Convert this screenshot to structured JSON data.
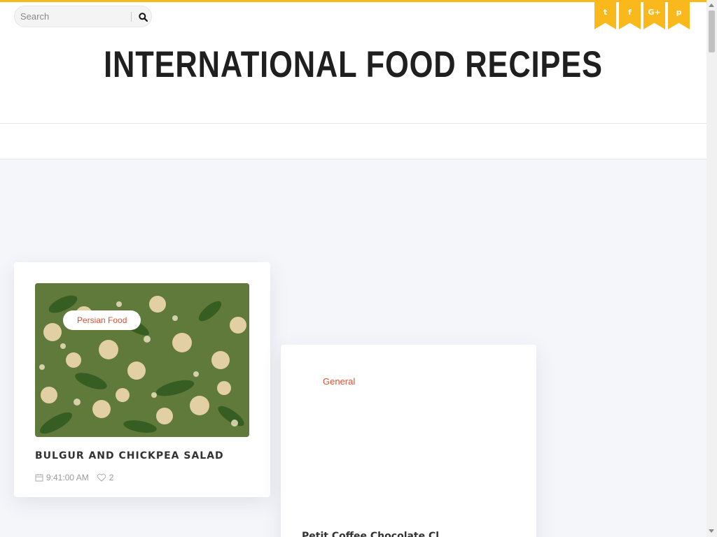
{
  "search": {
    "placeholder": "Search"
  },
  "social": [
    "twitter-icon",
    "facebook-icon",
    "google-plus-icon",
    "pinterest-icon"
  ],
  "social_glyphs": {
    "twitter": "t",
    "facebook": "f",
    "google": "G+",
    "pinterest": "p"
  },
  "site": {
    "title": "INTERNATIONAL FOOD RECIPES"
  },
  "colors": {
    "accent": "#f9b91c",
    "category": "#dd5030",
    "background": "#f5f6fa"
  },
  "posts": [
    {
      "category": "Persian Food",
      "title": "BULGUR AND CHICKPEA SALAD",
      "time": "9:41:00 AM",
      "likes": "2"
    },
    {
      "category": "General",
      "title": "Petit Coffee Chocolate Cl..."
    }
  ]
}
